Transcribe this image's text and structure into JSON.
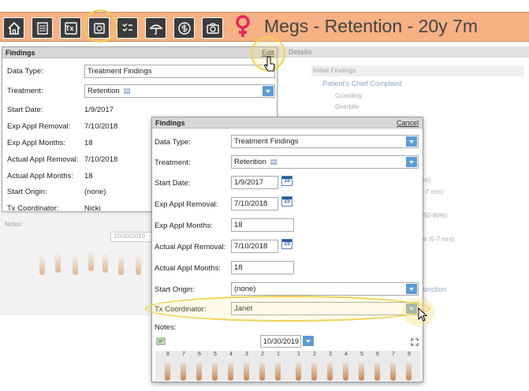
{
  "toolbar": {
    "patient_title": "Megs - Retention - 20y 7m",
    "buttons": [
      "home-icon",
      "checklist-icon",
      "tx-icon",
      "treatment-card-icon",
      "tasks-icon",
      "umbrella-icon",
      "billing-icon",
      "camera-icon"
    ],
    "tx_text": "Tx"
  },
  "colors": {
    "accent": "#f6b184",
    "patient_icon": "#e4245d",
    "highlight": "#f0d050",
    "dropdown": "#5b9bd5"
  },
  "bg_panel": {
    "title": "Findings",
    "edit_label": "Edit",
    "details_header": "Details",
    "rows": {
      "data_type_label": "Data Type:",
      "data_type_value": "Treatment Findings",
      "treatment_label": "Treatment:",
      "treatment_value": "Retention",
      "start_date_label": "Start Date:",
      "start_date_value": "1/9/2017",
      "exp_removal_label": "Exp Appl Removal:",
      "exp_removal_value": "7/10/2018",
      "exp_months_label": "Exp Appl Months:",
      "exp_months_value": "18",
      "actual_removal_label": "Actual Appl Removal:",
      "actual_removal_value": "7/10/2018",
      "actual_months_label": "Actual Appl Months:",
      "actual_months_value": "18",
      "start_origin_label": "Start Origin:",
      "start_origin_value": "(none)",
      "coordinator_label": "Tx Coordinator:",
      "coordinator_value": "Nicki"
    },
    "notes_label": "Notes:",
    "date_value": "10/30/2019"
  },
  "details_panel": {
    "initial_findings": "Initial Findings",
    "chief_complaint": "Patient's Chief Complaint",
    "crowding": "Crowding",
    "overbite": "Overbite",
    "frag1": "m)",
    "frag2": "-7 mm)",
    "frag3": "50-80%)",
    "frag4": "e (5-7 mm)",
    "frag5": "unction"
  },
  "front_panel": {
    "title": "Findings",
    "cancel_label": "Cancel",
    "data_type_label": "Data Type:",
    "data_type_value": "Treatment Findings",
    "treatment_label": "Treatment:",
    "treatment_value": "Retention",
    "start_date_label": "Start Date:",
    "start_date_value": "1/9/2017",
    "exp_removal_label": "Exp Appl Removal:",
    "exp_removal_value": "7/10/2018",
    "exp_months_label": "Exp Appl Months:",
    "exp_months_value": "18",
    "actual_removal_label": "Actual Appl Removal:",
    "actual_removal_value": "7/10/2018",
    "actual_months_label": "Actual Appl Months:",
    "actual_months_value": "18",
    "start_origin_label": "Start Origin:",
    "start_origin_value": "(none)",
    "coordinator_label": "Tx Coordinator:",
    "coordinator_value": "Janet",
    "notes_label": "Notes:",
    "notes_date": "10/30/2019",
    "calendar_day": "15",
    "tooth_numbers": [
      "8",
      "7",
      "6",
      "5",
      "4",
      "3",
      "2",
      "1",
      "1",
      "2",
      "3",
      "4",
      "5",
      "6",
      "7",
      "8"
    ]
  }
}
